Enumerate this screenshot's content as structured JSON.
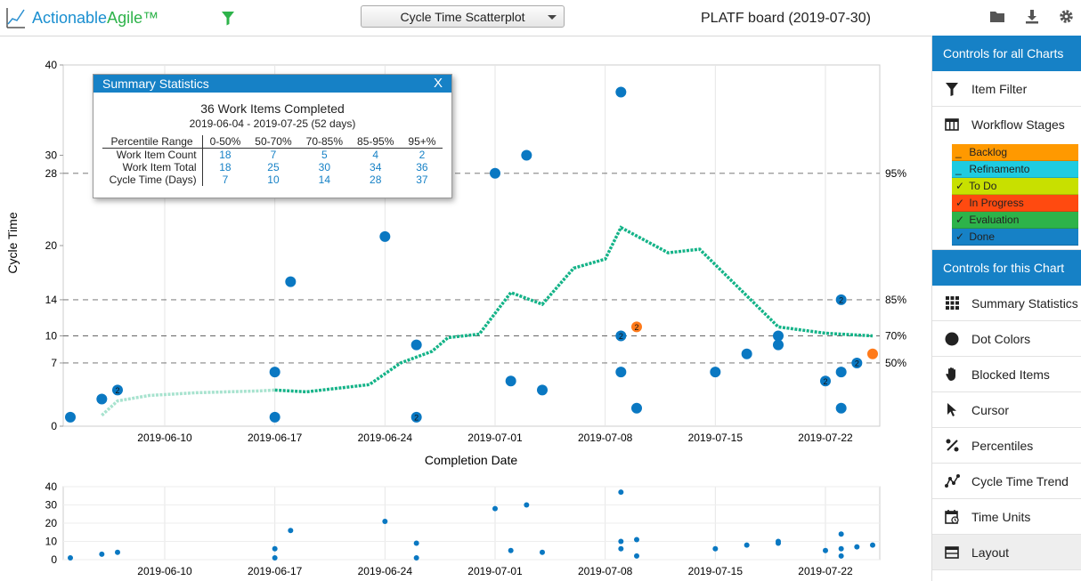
{
  "app": {
    "logo_part1": "Actionable",
    "logo_part2": "Agile™",
    "chart_selector": "Cycle Time Scatterplot",
    "board_title": "PLATF board (2019-07-30)"
  },
  "sidebar": {
    "all_header": "Controls for all Charts",
    "all_items": [
      {
        "label": "Item Filter",
        "icon": "funnel-icon"
      },
      {
        "label": "Workflow Stages",
        "icon": "columns-icon"
      }
    ],
    "stages": [
      {
        "check": "_",
        "label": "Backlog",
        "color": "#ff9900"
      },
      {
        "check": "_",
        "label": "Refinamento",
        "color": "#1ecbe1"
      },
      {
        "check": "✓",
        "label": "To Do",
        "color": "#c8e000"
      },
      {
        "check": "✓",
        "label": "In Progress",
        "color": "#ff4a10"
      },
      {
        "check": "✓",
        "label": "Evaluation",
        "color": "#2db34a"
      },
      {
        "check": "✓",
        "label": "Done",
        "color": "#1681c6"
      }
    ],
    "chart_header": "Controls for this Chart",
    "chart_items": [
      {
        "label": "Summary Statistics",
        "icon": "grid-icon"
      },
      {
        "label": "Dot Colors",
        "icon": "dot-icon"
      },
      {
        "label": "Blocked Items",
        "icon": "hand-icon"
      },
      {
        "label": "Cursor",
        "icon": "cursor-icon"
      },
      {
        "label": "Percentiles",
        "icon": "percent-icon"
      },
      {
        "label": "Cycle Time Trend",
        "icon": "trend-icon"
      },
      {
        "label": "Time Units",
        "icon": "calendar-icon"
      },
      {
        "label": "Layout",
        "icon": "layout-icon"
      }
    ]
  },
  "summary": {
    "header": "Summary Statistics",
    "close": "X",
    "title": "36 Work Items Completed",
    "range": "2019-06-04 - 2019-07-25 (52 days)",
    "columns": [
      "Percentile Range",
      "0-50%",
      "50-70%",
      "70-85%",
      "85-95%",
      "95+%"
    ],
    "rows": [
      {
        "label": "Work Item Count",
        "values": [
          "18",
          "7",
          "5",
          "4",
          "2"
        ]
      },
      {
        "label": "Work Item Total",
        "values": [
          "18",
          "25",
          "30",
          "34",
          "36"
        ]
      },
      {
        "label": "Cycle Time (Days)",
        "values": [
          "7",
          "10",
          "14",
          "28",
          "37"
        ]
      }
    ]
  },
  "chart_data": {
    "type": "scatter",
    "xlabel": "Completion Date",
    "ylabel": "Cycle Time",
    "x_start": "2019-06-04",
    "x_end": "2019-07-25",
    "x_ticks": [
      "2019-06-10",
      "2019-06-17",
      "2019-06-24",
      "2019-07-01",
      "2019-07-08",
      "2019-07-15",
      "2019-07-22"
    ],
    "y_ticks": [
      0,
      7,
      10,
      14,
      20,
      28,
      30,
      40
    ],
    "ylim": [
      0,
      40
    ],
    "percentiles": [
      {
        "label": "95%",
        "value": 28
      },
      {
        "label": "85%",
        "value": 14
      },
      {
        "label": "70%",
        "value": 10
      },
      {
        "label": "50%",
        "value": 7
      }
    ],
    "points": [
      {
        "date": "2019-06-04",
        "value": 1
      },
      {
        "date": "2019-06-06",
        "value": 3
      },
      {
        "date": "2019-06-07",
        "value": 4,
        "count": "2"
      },
      {
        "date": "2019-06-17",
        "value": 1
      },
      {
        "date": "2019-06-17",
        "value": 6
      },
      {
        "date": "2019-06-18",
        "value": 16
      },
      {
        "date": "2019-06-24",
        "value": 21
      },
      {
        "date": "2019-06-26",
        "value": 1,
        "count": "2"
      },
      {
        "date": "2019-06-26",
        "value": 9
      },
      {
        "date": "2019-07-01",
        "value": 28
      },
      {
        "date": "2019-07-02",
        "value": 5
      },
      {
        "date": "2019-07-03",
        "value": 30
      },
      {
        "date": "2019-07-04",
        "value": 4
      },
      {
        "date": "2019-07-09",
        "value": 37
      },
      {
        "date": "2019-07-09",
        "value": 10,
        "count": "2"
      },
      {
        "date": "2019-07-09",
        "value": 6
      },
      {
        "date": "2019-07-10",
        "value": 11,
        "count": "2",
        "color": "#ff7a1a"
      },
      {
        "date": "2019-07-10",
        "value": 2
      },
      {
        "date": "2019-07-15",
        "value": 6
      },
      {
        "date": "2019-07-17",
        "value": 8
      },
      {
        "date": "2019-07-19",
        "value": 10
      },
      {
        "date": "2019-07-19",
        "value": 9
      },
      {
        "date": "2019-07-22",
        "value": 5,
        "count": "2"
      },
      {
        "date": "2019-07-23",
        "value": 14,
        "count": "2"
      },
      {
        "date": "2019-07-23",
        "value": 6
      },
      {
        "date": "2019-07-23",
        "value": 2
      },
      {
        "date": "2019-07-24",
        "value": 7,
        "count": "2"
      },
      {
        "date": "2019-07-25",
        "value": 8,
        "color": "#ff7a1a"
      }
    ],
    "trend": [
      {
        "date": "2019-06-06",
        "value": 1.2
      },
      {
        "date": "2019-06-07",
        "value": 2.8
      },
      {
        "date": "2019-06-09",
        "value": 3.4
      },
      {
        "date": "2019-06-12",
        "value": 3.7
      },
      {
        "date": "2019-06-16",
        "value": 3.9
      },
      {
        "date": "2019-06-17",
        "value": 4.0
      },
      {
        "date": "2019-06-19",
        "value": 3.8
      },
      {
        "date": "2019-06-23",
        "value": 4.6
      },
      {
        "date": "2019-06-25",
        "value": 7.0
      },
      {
        "date": "2019-06-27",
        "value": 8.3
      },
      {
        "date": "2019-06-28",
        "value": 9.8
      },
      {
        "date": "2019-06-30",
        "value": 10.2
      },
      {
        "date": "2019-07-02",
        "value": 14.8
      },
      {
        "date": "2019-07-04",
        "value": 13.5
      },
      {
        "date": "2019-07-06",
        "value": 17.5
      },
      {
        "date": "2019-07-08",
        "value": 18.5
      },
      {
        "date": "2019-07-09",
        "value": 22.0
      },
      {
        "date": "2019-07-12",
        "value": 19.2
      },
      {
        "date": "2019-07-14",
        "value": 19.6
      },
      {
        "date": "2019-07-19",
        "value": 11.0
      },
      {
        "date": "2019-07-22",
        "value": 10.3
      },
      {
        "date": "2019-07-25",
        "value": 10.0
      }
    ],
    "overview_y_ticks": [
      0,
      10,
      20,
      30,
      40
    ]
  },
  "colors": {
    "accent": "#1681c6",
    "dot": "#0a78c2",
    "trend": "#14b388",
    "trend_faded": "#a8e3cf",
    "orange": "#ff7a1a"
  }
}
